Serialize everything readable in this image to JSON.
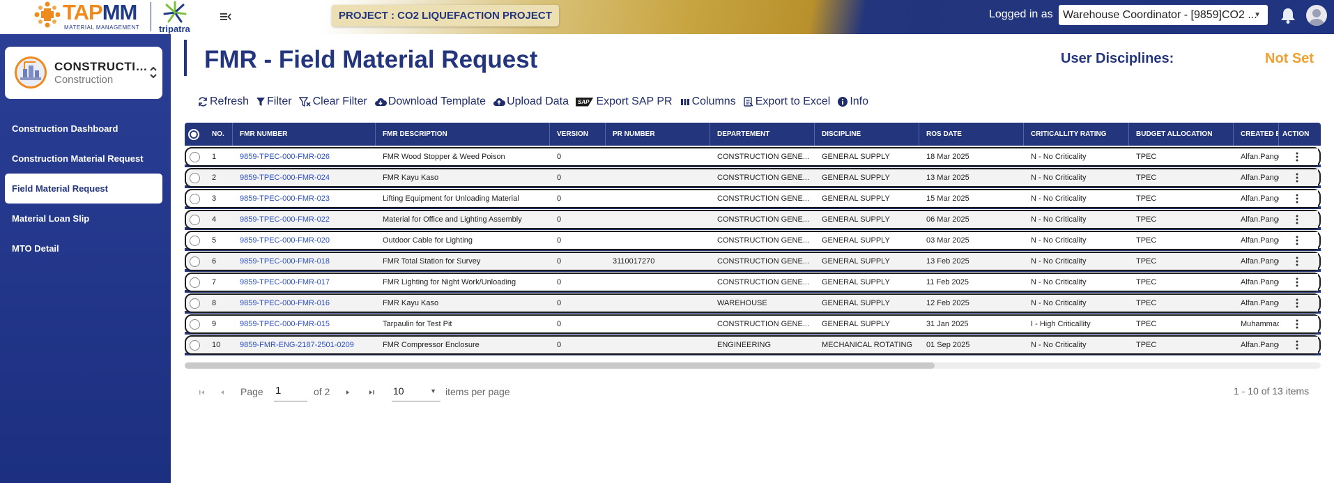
{
  "header": {
    "brand_main": "TAP",
    "brand_accent": "MM",
    "brand_sub": "MATERIAL MANAGEMENT",
    "partner_name": "tripatra",
    "project": "PROJECT : CO2 LIQUEFACTION PROJECT",
    "logged_in_label": "Logged in as",
    "role": "Warehouse Coordinator - [9859]CO2 ..."
  },
  "sidebar": {
    "module": {
      "name": "CONSTRUCTION",
      "sub": "Construction"
    },
    "items": [
      {
        "label": "Construction Dashboard",
        "active": false
      },
      {
        "label": "Construction Material Request",
        "active": false
      },
      {
        "label": "Field Material Request",
        "active": true
      },
      {
        "label": "Material Loan Slip",
        "active": false
      },
      {
        "label": "MTO Detail",
        "active": false
      }
    ]
  },
  "page": {
    "title": "FMR - Field Material Request",
    "disciplines_label": "User Disciplines:",
    "disciplines_value": "Not Set"
  },
  "toolbar": {
    "refresh": "Refresh",
    "filter": "Filter",
    "clear_filter": "Clear Filter",
    "download_template": "Download Template",
    "upload_data": "Upload Data",
    "sap_badge": "SAP",
    "export_sap_pr": "Export SAP PR",
    "columns": "Columns",
    "export_excel": "Export to Excel",
    "info": "Info"
  },
  "table": {
    "headers": [
      "NO.",
      "FMR NUMBER",
      "FMR DESCRIPTION",
      "VERSION",
      "PR NUMBER",
      "DEPARTEMENT",
      "DISCIPLINE",
      "ROS DATE",
      "CRITICALLITY RATING",
      "BUDGET ALLOCATION",
      "CREATED BY",
      "ACTION"
    ],
    "rows": [
      [
        "1",
        "9859-TPEC-000-FMR-026",
        "FMR Wood Stopper & Weed Poison",
        "0",
        "",
        "CONSTRUCTION GENE...",
        "GENERAL SUPPLY",
        "18 Mar 2025",
        "N - No Criticality",
        "TPEC",
        "Alfan.Pangestu"
      ],
      [
        "2",
        "9859-TPEC-000-FMR-024",
        "FMR Kayu Kaso",
        "0",
        "",
        "CONSTRUCTION GENE...",
        "GENERAL SUPPLY",
        "13 Mar 2025",
        "N - No Criticality",
        "TPEC",
        "Alfan.Pangestu"
      ],
      [
        "3",
        "9859-TPEC-000-FMR-023",
        "Lifting Equipment for Unloading Material",
        "0",
        "",
        "CONSTRUCTION GENE...",
        "GENERAL SUPPLY",
        "15 Mar 2025",
        "N - No Criticality",
        "TPEC",
        "Alfan.Pangestu"
      ],
      [
        "4",
        "9859-TPEC-000-FMR-022",
        "Material for Office and Lighting Assembly",
        "0",
        "",
        "CONSTRUCTION GENE...",
        "GENERAL SUPPLY",
        "06 Mar 2025",
        "N - No Criticality",
        "TPEC",
        "Alfan.Pangestu"
      ],
      [
        "5",
        "9859-TPEC-000-FMR-020",
        "Outdoor Cable for Lighting",
        "0",
        "",
        "CONSTRUCTION GENE...",
        "GENERAL SUPPLY",
        "03 Mar 2025",
        "N - No Criticality",
        "TPEC",
        "Alfan.Pangestu"
      ],
      [
        "6",
        "9859-TPEC-000-FMR-018",
        "FMR Total Station for Survey",
        "0",
        "3110017270",
        "CONSTRUCTION GENE...",
        "GENERAL SUPPLY",
        "13 Feb 2025",
        "N - No Criticality",
        "TPEC",
        "Alfan.Pangestu"
      ],
      [
        "7",
        "9859-TPEC-000-FMR-017",
        "FMR Lighting for Night Work/Unloading",
        "0",
        "",
        "CONSTRUCTION GENE...",
        "GENERAL SUPPLY",
        "11 Feb 2025",
        "N - No Criticality",
        "TPEC",
        "Alfan.Pangestu"
      ],
      [
        "8",
        "9859-TPEC-000-FMR-016",
        "FMR Kayu Kaso",
        "0",
        "",
        "WAREHOUSE",
        "GENERAL SUPPLY",
        "12 Feb 2025",
        "N - No Criticality",
        "TPEC",
        "Alfan.Pangestu"
      ],
      [
        "9",
        "9859-TPEC-000-FMR-015",
        "Tarpaulin for Test Pit",
        "0",
        "",
        "CONSTRUCTION GENE...",
        "GENERAL SUPPLY",
        "31 Jan 2025",
        "I - High Criticallity",
        "TPEC",
        "Muhammad"
      ],
      [
        "10",
        "9859-FMR-ENG-2187-2501-0209",
        "FMR Compressor Enclosure",
        "0",
        "",
        "ENGINEERING",
        "MECHANICAL ROTATING",
        "01 Sep 2025",
        "N - No Criticality",
        "TPEC",
        "Alfan.Pangestu"
      ]
    ]
  },
  "pager": {
    "page_label": "Page",
    "page_value": "1",
    "of_label": "of 2",
    "page_size": "10",
    "items_per_page": "items per page",
    "range": "1 - 10 of 13 items"
  },
  "colors": {
    "primary": "#23357c",
    "accent_orange": "#f0a030",
    "link": "#2b4fc4"
  },
  "icons": [
    "refresh-icon",
    "filter-icon",
    "clear-filter-icon",
    "download-icon",
    "upload-icon",
    "sap-icon",
    "columns-icon",
    "excel-icon",
    "info-icon",
    "menu-icon",
    "bell-icon",
    "avatar-icon",
    "kebab-icon"
  ]
}
